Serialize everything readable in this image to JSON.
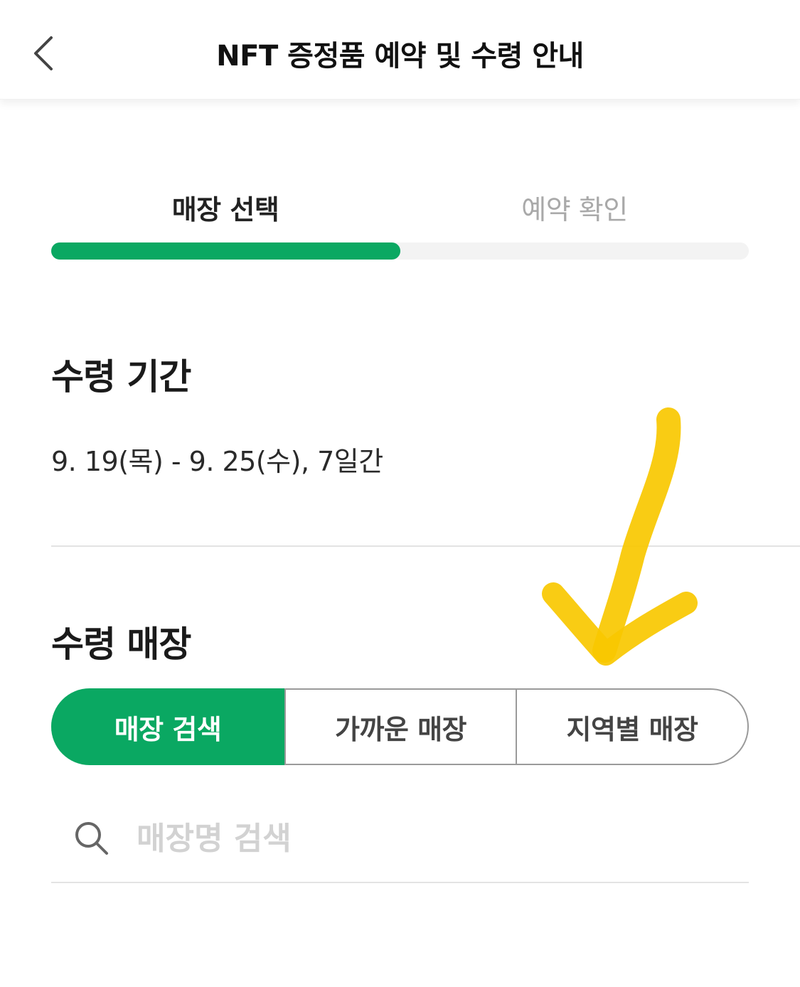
{
  "header": {
    "title": "NFT 증정품 예약 및 수령 안내",
    "back_icon": "chevron-left-icon"
  },
  "steps": {
    "tabs": [
      {
        "label": "매장 선택",
        "active": true
      },
      {
        "label": "예약 확인",
        "active": false
      }
    ],
    "progress": 0.5,
    "accent_color": "#0aa862"
  },
  "pickup_period": {
    "title": "수령 기간",
    "text": "9. 19(목) - 9. 25(수), 7일간"
  },
  "pickup_store": {
    "title": "수령 매장",
    "segments": [
      {
        "label": "매장 검색",
        "selected": true
      },
      {
        "label": "가까운 매장",
        "selected": false
      },
      {
        "label": "지역별 매장",
        "selected": false
      }
    ],
    "search": {
      "placeholder": "매장명 검색",
      "value": "",
      "icon": "search-icon"
    }
  },
  "annotation": {
    "icon": "arrow-down-annotation-icon",
    "color": "#f9c800"
  }
}
